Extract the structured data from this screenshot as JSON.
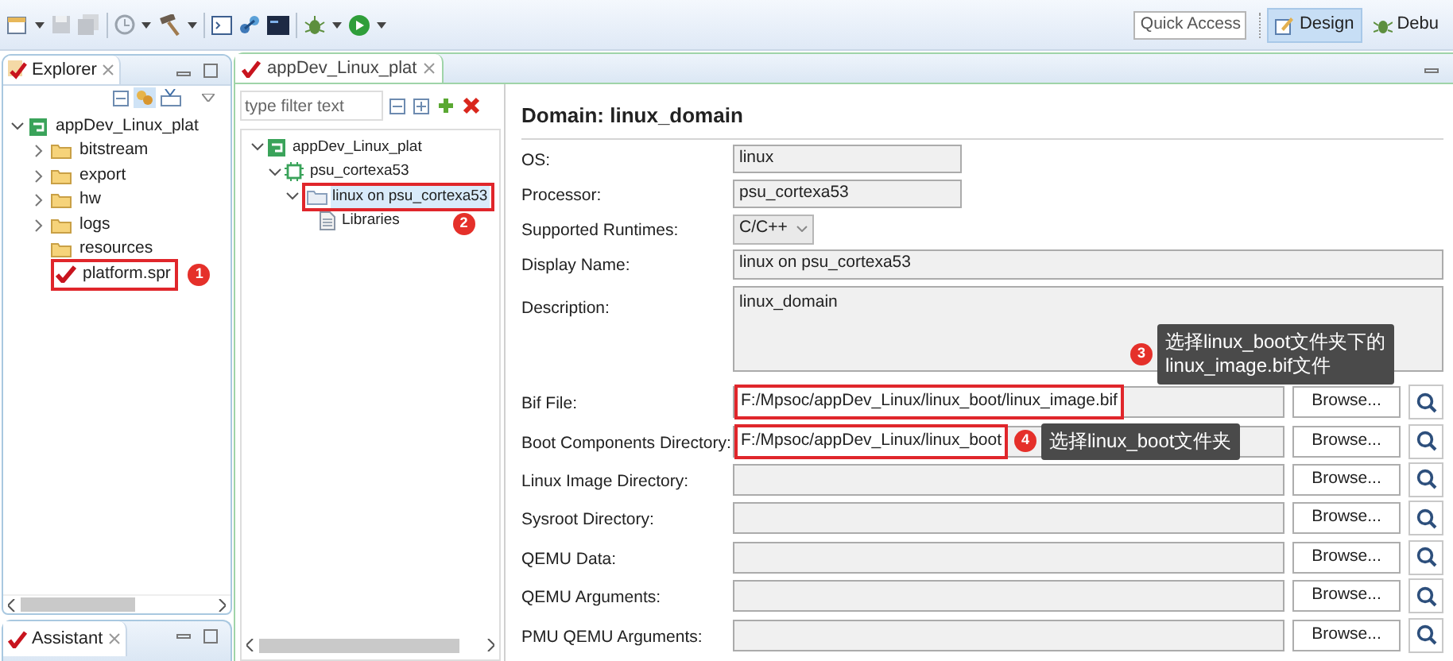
{
  "toolbar": {
    "quick_access": "Quick Access",
    "perspectives": [
      {
        "label": "Design",
        "selected": true
      },
      {
        "label": "Debu",
        "selected": false
      }
    ]
  },
  "explorer": {
    "title": "Explorer",
    "tree": [
      {
        "label": "appDev_Linux_plat",
        "kind": "project",
        "expandable": true,
        "expanded": true,
        "highlighted": false,
        "selected": false,
        "children": [
          {
            "label": "bitstream",
            "kind": "folder",
            "expandable": true,
            "expanded": false,
            "highlighted": false,
            "selected": false
          },
          {
            "label": "export",
            "kind": "folder",
            "expandable": true,
            "expanded": false,
            "highlighted": false,
            "selected": false
          },
          {
            "label": "hw",
            "kind": "folder",
            "expandable": true,
            "expanded": false,
            "highlighted": false,
            "selected": false
          },
          {
            "label": "logs",
            "kind": "folder",
            "expandable": true,
            "expanded": false,
            "highlighted": false,
            "selected": false
          },
          {
            "label": "resources",
            "kind": "folder",
            "expandable": false,
            "highlighted": false,
            "selected": false
          },
          {
            "label": "platform.spr",
            "kind": "platform",
            "expandable": false,
            "highlighted": true,
            "selected": false,
            "badge": "1"
          }
        ]
      }
    ]
  },
  "assistant": {
    "title": "Assistant"
  },
  "editor": {
    "tab": "appDev_Linux_plat",
    "filter": {
      "placeholder": "type filter text"
    },
    "tree": [
      {
        "label": "appDev_Linux_plat",
        "kind": "project",
        "expandable": true,
        "expanded": true,
        "highlighted": false,
        "selected": false,
        "children": [
          {
            "label": "psu_cortexa53",
            "kind": "processor",
            "expandable": true,
            "expanded": true,
            "highlighted": false,
            "selected": false,
            "children": [
              {
                "label": "linux on psu_cortexa53",
                "kind": "domain",
                "expandable": true,
                "expanded": true,
                "highlighted": true,
                "selected": true,
                "badge": "2",
                "children": [
                  {
                    "label": "Libraries",
                    "kind": "library",
                    "expandable": false,
                    "highlighted": false,
                    "selected": false
                  }
                ]
              }
            ]
          }
        ]
      }
    ],
    "heading": "Domain: linux_domain",
    "fields": [
      {
        "kind": "short",
        "label": "OS:",
        "value": "linux"
      },
      {
        "kind": "short",
        "label": "Processor:",
        "value": "psu_cortexa53"
      },
      {
        "kind": "select",
        "label": "Supported Runtimes:",
        "value": "C/C++"
      },
      {
        "kind": "text",
        "label": "Display Name:",
        "value": "linux on psu_cortexa53"
      },
      {
        "kind": "textarea",
        "label": "Description:",
        "value": "linux_domain"
      },
      {
        "kind": "path",
        "label": "Bif File:",
        "value": "F:/Mpsoc/appDev_Linux/linux_boot/linux_image.bif",
        "button": "Browse...",
        "highlighted": true,
        "badge": "3",
        "note": "选择linux_boot文件夹下的\nlinux_image.bif文件"
      },
      {
        "kind": "path",
        "label": "Boot Components Directory:",
        "value": "F:/Mpsoc/appDev_Linux/linux_boot",
        "button": "Browse...",
        "highlighted": true,
        "badge": "4",
        "note": "选择linux_boot文件夹"
      },
      {
        "kind": "path",
        "label": "Linux Image Directory:",
        "button": "Browse...",
        "highlighted": false
      },
      {
        "kind": "path",
        "label": "Sysroot Directory:",
        "button": "Browse...",
        "highlighted": false
      },
      {
        "kind": "path",
        "label": "QEMU Data:",
        "button": "Browse...",
        "highlighted": false
      },
      {
        "kind": "path",
        "label": "QEMU Arguments:",
        "button": "Browse...",
        "highlighted": false
      },
      {
        "kind": "path",
        "label": "PMU QEMU Arguments:",
        "button": "Browse...",
        "highlighted": false
      }
    ]
  }
}
